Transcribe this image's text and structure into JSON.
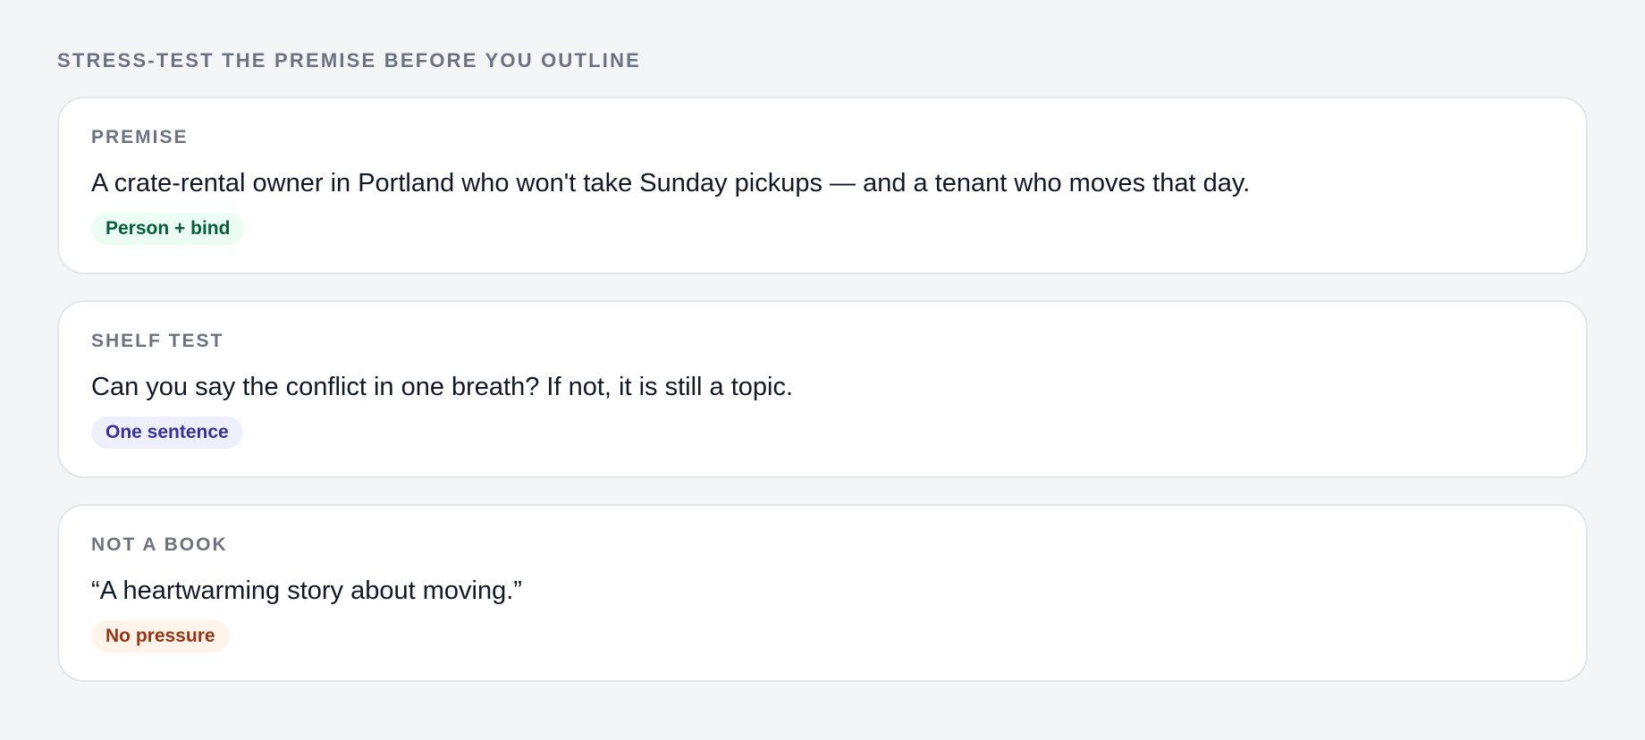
{
  "heading": "STRESS-TEST THE PREMISE BEFORE YOU OUTLINE",
  "cards": [
    {
      "label": "PREMISE",
      "text": "A crate-rental owner in Portland who won't take Sunday pickups — and a tenant who moves that day.",
      "tag": "Person + bind",
      "tag_color": "#05603a"
    },
    {
      "label": "SHELF TEST",
      "text": "Can you say the conflict in one breath? If not, it is still a topic.",
      "tag": "One sentence",
      "tag_color": "#3730a3"
    },
    {
      "label": "NOT A BOOK",
      "text": "“A heartwarming story about moving.”",
      "tag": "No pressure",
      "tag_color": "#9a3412"
    }
  ]
}
